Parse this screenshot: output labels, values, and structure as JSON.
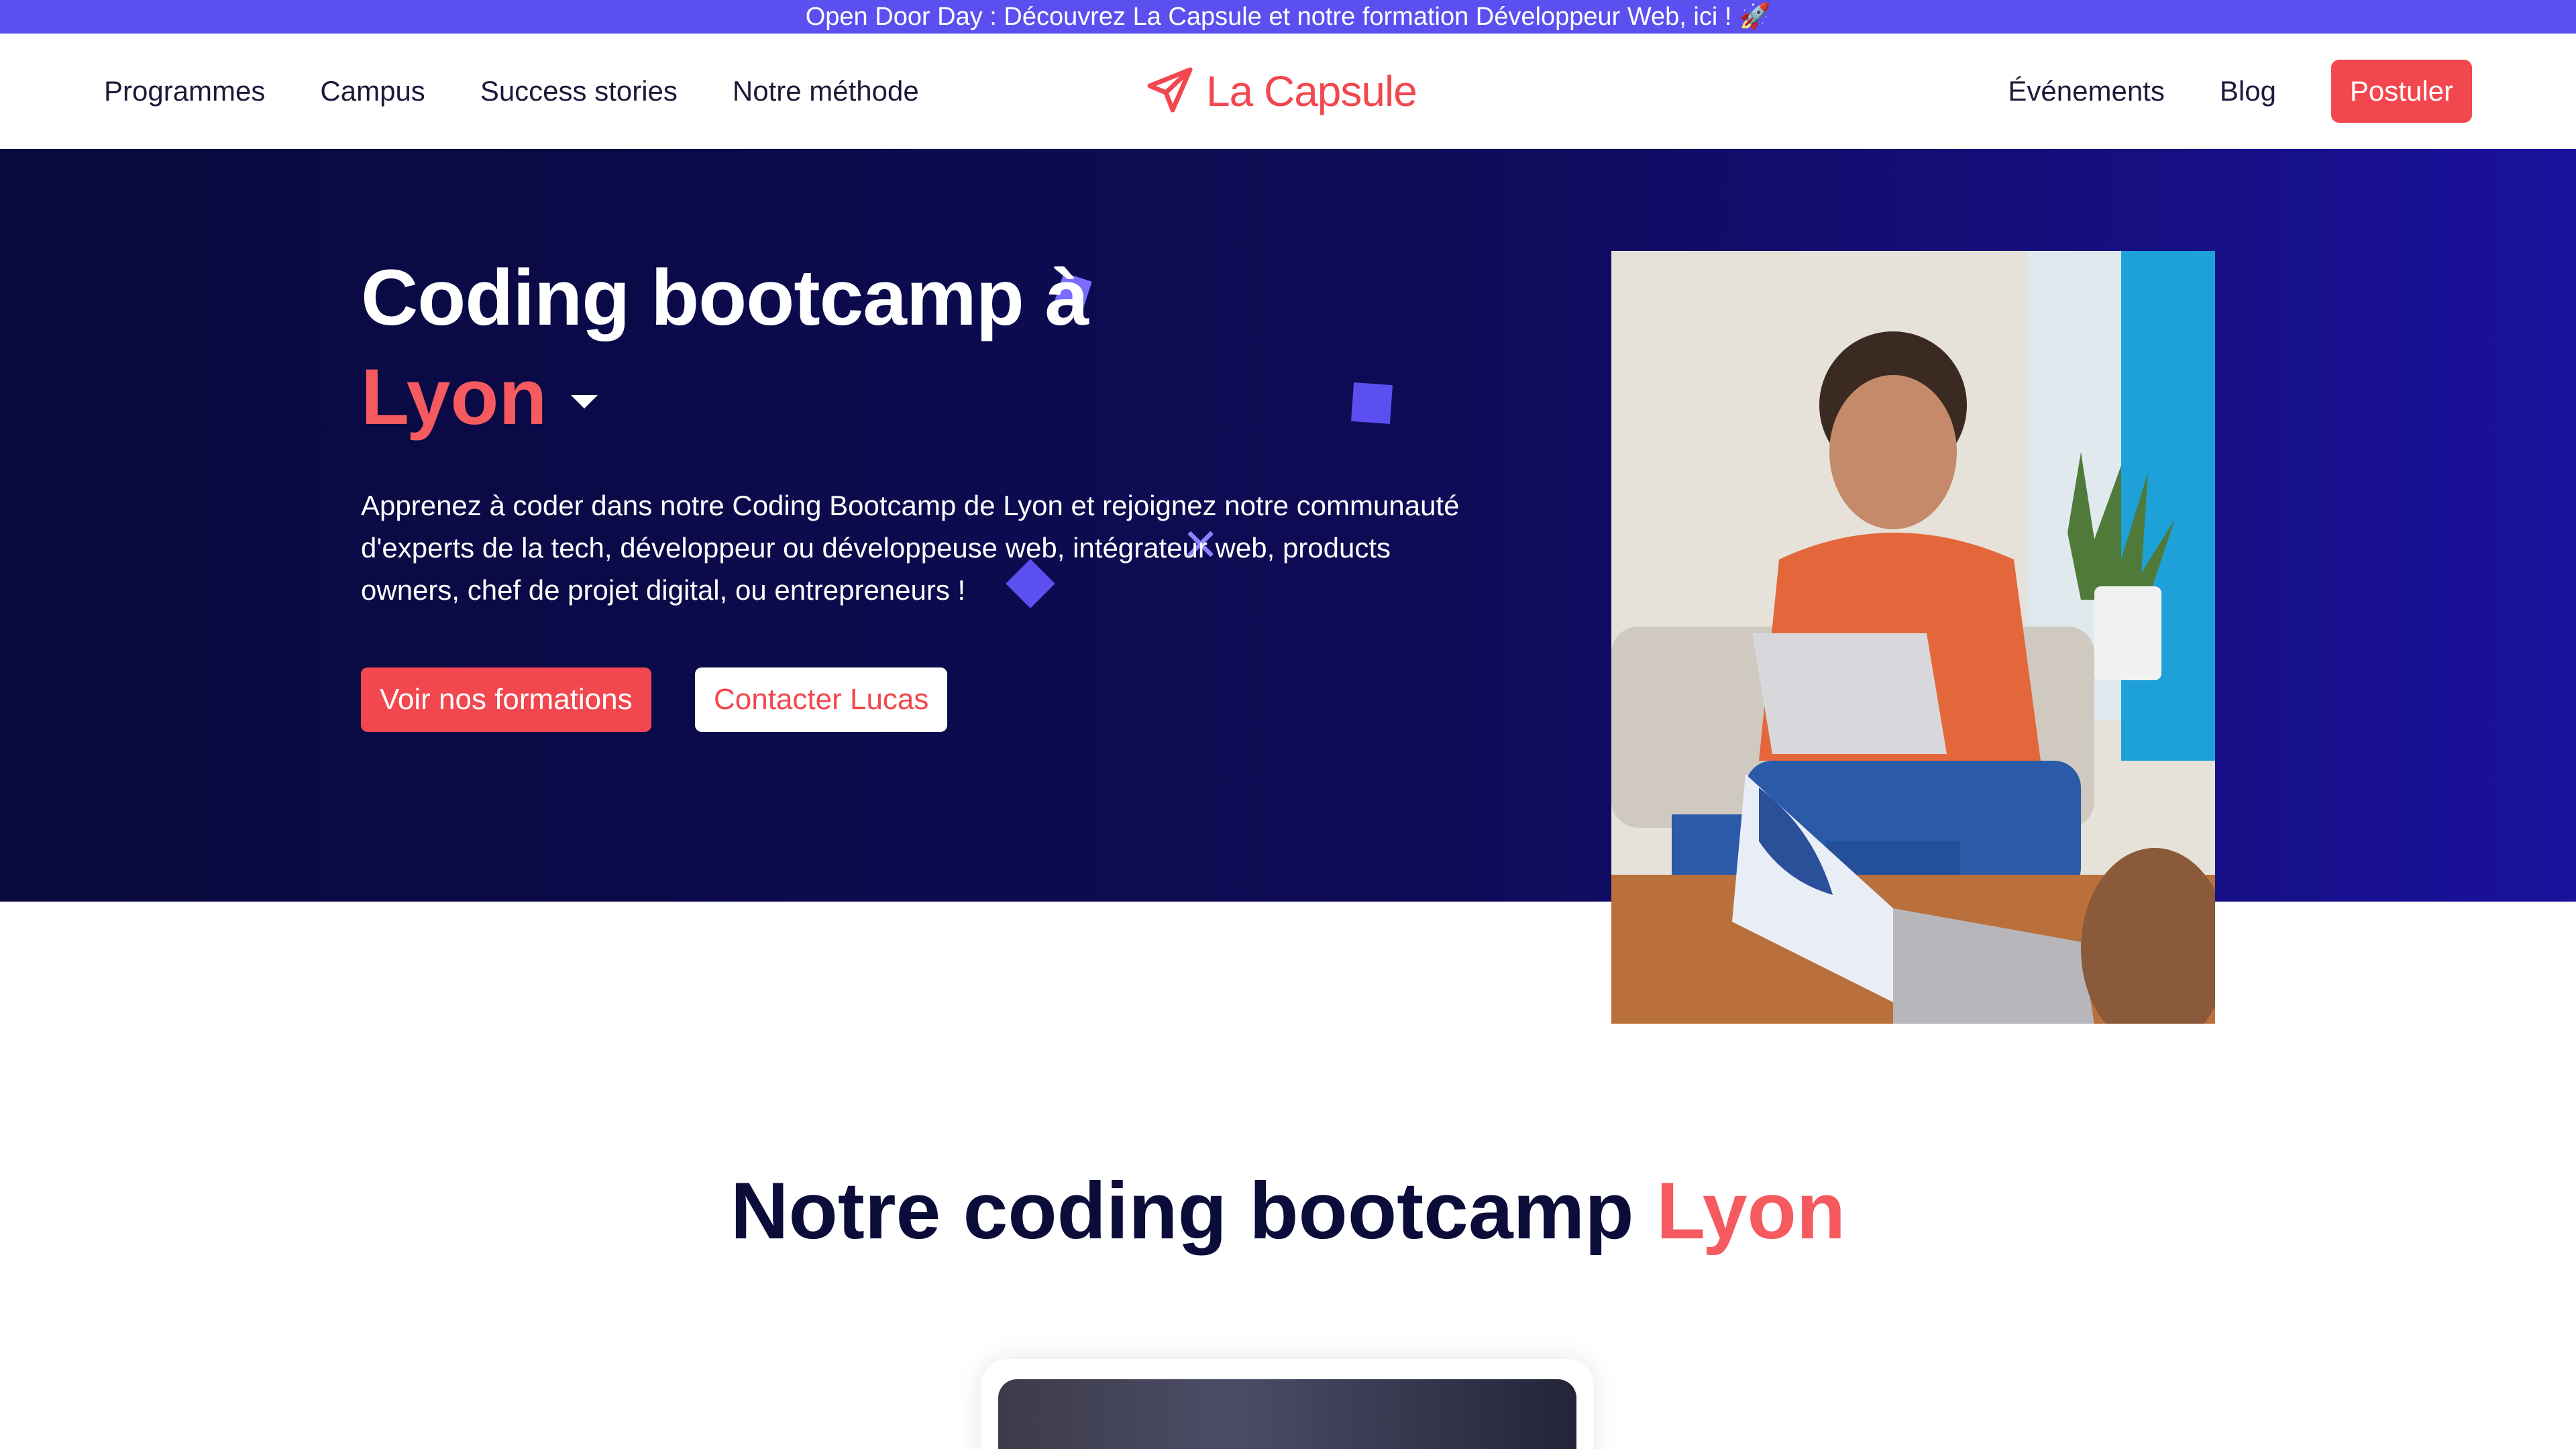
{
  "banner": {
    "text": "Open Door Day : Découvrez La Capsule et notre formation Développeur Web, ici ! 🚀"
  },
  "nav": {
    "left": [
      {
        "label": "Programmes"
      },
      {
        "label": "Campus"
      },
      {
        "label": "Success stories"
      },
      {
        "label": "Notre méthode"
      }
    ],
    "logo_text": "La Capsule",
    "right": [
      {
        "label": "Événements"
      },
      {
        "label": "Blog"
      }
    ],
    "cta": "Postuler"
  },
  "hero": {
    "title": "Coding bootcamp à",
    "city": "Lyon",
    "description": "Apprenez à coder dans notre Coding Bootcamp de Lyon et rejoignez notre communauté d'experts de la tech, développeur ou développeuse web, intégrateur web, products owners, chef de projet digital, ou entrepreneurs !",
    "primary_button": "Voir nos formations",
    "secondary_button": "Contacter Lucas"
  },
  "section": {
    "title_main": "Notre coding bootcamp",
    "title_accent": "Lyon"
  },
  "colors": {
    "brand": "#f2474f",
    "banner": "#5b4ff0",
    "hero_dark": "#0e0b56",
    "accent_text": "#f55a5f"
  },
  "icons": {
    "logo": "paper-plane-icon",
    "city_dropdown": "caret-down-icon"
  }
}
